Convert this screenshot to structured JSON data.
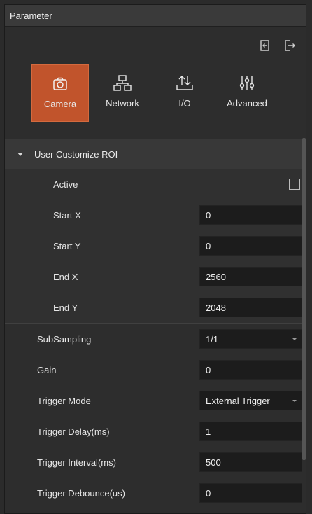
{
  "window": {
    "title": "Parameter"
  },
  "toolbar": {
    "import_icon": "import-icon",
    "export_icon": "export-icon"
  },
  "tabs": [
    {
      "label": "Camera",
      "icon": "camera-icon",
      "active": true
    },
    {
      "label": "Network",
      "icon": "network-icon",
      "active": false
    },
    {
      "label": "I/O",
      "icon": "io-icon",
      "active": false
    },
    {
      "label": "Advanced",
      "icon": "sliders-icon",
      "active": false
    }
  ],
  "roi": {
    "header": "User Customize ROI",
    "active_label": "Active",
    "active_checked": false,
    "start_x_label": "Start X",
    "start_x_value": "0",
    "start_y_label": "Start Y",
    "start_y_value": "0",
    "end_x_label": "End X",
    "end_x_value": "2560",
    "end_y_label": "End Y",
    "end_y_value": "2048"
  },
  "params": {
    "subsampling_label": "SubSampling",
    "subsampling_value": "1/1",
    "gain_label": "Gain",
    "gain_value": "0",
    "trigger_mode_label": "Trigger Mode",
    "trigger_mode_value": "External Trigger",
    "trigger_delay_label": "Trigger Delay(ms)",
    "trigger_delay_value": "1",
    "trigger_interval_label": "Trigger Interval(ms)",
    "trigger_interval_value": "500",
    "trigger_debounce_label": "Trigger Debounce(us)",
    "trigger_debounce_value": "0"
  },
  "colors": {
    "accent": "#c1542c",
    "panel": "#2d2d2d",
    "field": "#1c1c1c"
  }
}
